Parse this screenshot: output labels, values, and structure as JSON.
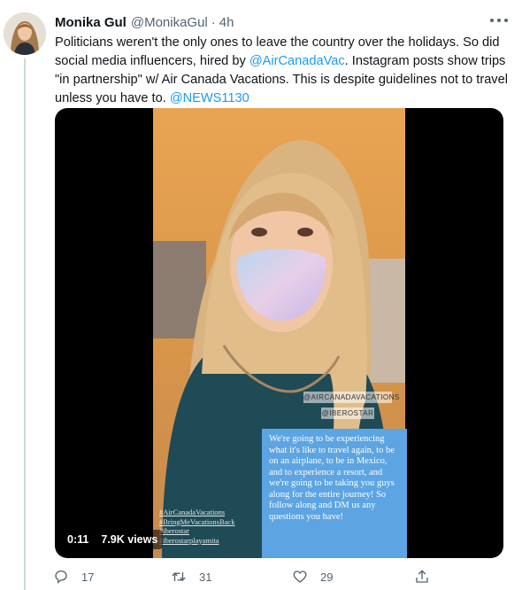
{
  "tweet": {
    "author": {
      "name": "Monika Gul",
      "handle": "@MonikaGul",
      "separator": "·",
      "time": "4h"
    },
    "text": {
      "part1": "Politicians weren't the only ones to leave the country over the holidays. So did social media influencers, hired by ",
      "mention1": "@AirCanadaVac",
      "part2": ". Instagram posts show trips \"in partnership\" w/ Air Canada Vacations. This is despite guidelines not to travel unless you have to. ",
      "mention2": "@NEWS1130"
    },
    "media": {
      "video_time": "0:11",
      "views": "7.9K views",
      "ig_tags": [
        "@AIRCANADAVACATIONS",
        "@IBEROSTAR"
      ],
      "caption": "We're going to be experiencing what it's like to travel again, to be on an airplane, to be in Mexico, and to experience a resort, and we're going to be taking you guys along for the entire journey! So follow along and DM us any questions you have!",
      "hashtags": [
        "#AirCanadaVacations",
        "#BringMeVacationsBack",
        "#iberostar",
        "#iberostarplayamita"
      ]
    },
    "actions": {
      "replies": "17",
      "retweets": "31",
      "likes": "29"
    },
    "colors": {
      "accent": "#1d9bf0",
      "secondary_text": "#536471",
      "caption_bg": "#5da4e2"
    },
    "icons": [
      "more-icon",
      "reply-icon",
      "retweet-icon",
      "like-icon",
      "share-icon"
    ]
  }
}
